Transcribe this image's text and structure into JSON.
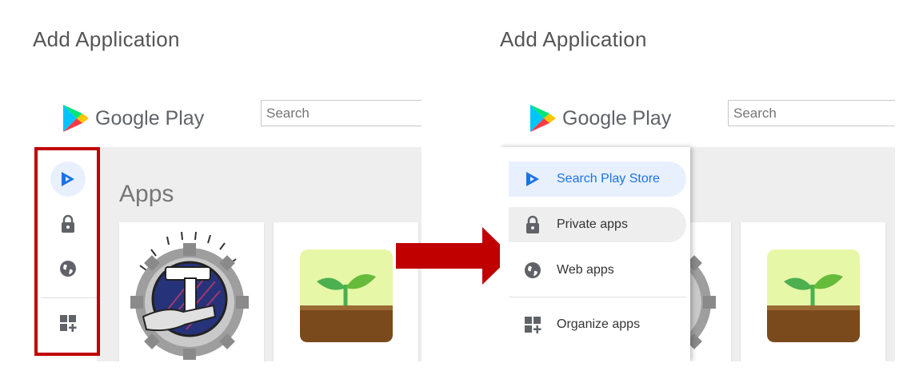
{
  "left": {
    "title": "Add Application",
    "brand": "Google Play",
    "search_placeholder": "Search",
    "section_title": "Apps",
    "rail_icons": [
      "play-store-icon",
      "lock-icon",
      "globe-icon",
      "organize-apps-icon"
    ]
  },
  "right": {
    "title": "Add Application",
    "brand": "Google Play",
    "search_placeholder": "Search",
    "drawer_items": [
      {
        "label": "Search Play Store",
        "icon": "play-store-icon",
        "state": "selected"
      },
      {
        "label": "Private apps",
        "icon": "lock-icon",
        "state": "hover"
      },
      {
        "label": "Web apps",
        "icon": "globe-icon",
        "state": "normal"
      },
      {
        "label": "Organize apps",
        "icon": "organize-apps-icon",
        "state": "normal"
      }
    ]
  },
  "colors": {
    "highlight_box": "#c00000",
    "arrow": "#c00000",
    "selected_bg": "#e8f0fe",
    "selected_text": "#1a73e8"
  }
}
